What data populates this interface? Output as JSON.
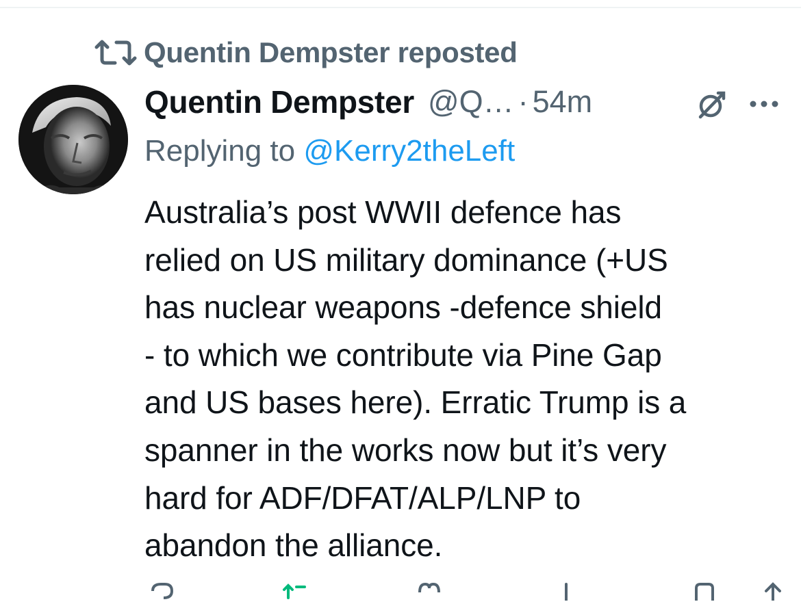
{
  "repost": {
    "icon": "repost-icon",
    "label": "Quentin Dempster reposted"
  },
  "tweet": {
    "avatar": "avatar",
    "author": {
      "display_name": "Quentin Dempster",
      "handle": "@Q…",
      "separator": "·",
      "time": "54m"
    },
    "replying": {
      "prefix": "Replying to ",
      "mention": "@Kerry2theLeft"
    },
    "body_lines": [
      "Australia’s post WWII defence has",
      "relied on US military dominance (+US",
      "has nuclear weapons -defence shield",
      "- to which we contribute via Pine Gap",
      "and US bases here). Erratic Trump is a",
      "spanner in the works now but it’s very",
      "hard for ADF/DFAT/ALP/LNP to",
      "abandon the alliance."
    ],
    "header_icons": [
      "grok-icon",
      "more-icon"
    ],
    "action_icons": [
      "reply-icon",
      "retweet-icon",
      "like-icon",
      "views-icon",
      "bookmark-icon",
      "share-icon"
    ]
  },
  "colors": {
    "text_primary": "#0f1419",
    "text_secondary": "#536471",
    "link": "#1d9bf0",
    "retweet_green": "#00ba7c",
    "divider": "#eff3f4"
  }
}
